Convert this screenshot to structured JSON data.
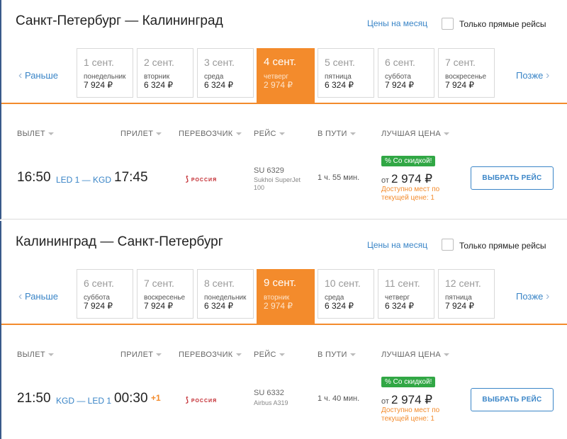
{
  "sections": [
    {
      "route": "Санкт-Петербург — Калининград",
      "month_link": "Цены на месяц",
      "direct_label": "Только прямые рейсы",
      "prev_label": "Раньше",
      "next_label": "Позже",
      "dates": [
        {
          "day": "1 сент.",
          "weekday": "понедельник",
          "price": "7 924 ₽"
        },
        {
          "day": "2 сент.",
          "weekday": "вторник",
          "price": "6 324 ₽"
        },
        {
          "day": "3 сент.",
          "weekday": "среда",
          "price": "6 324 ₽"
        },
        {
          "day": "4 сент.",
          "weekday": "четверг",
          "price": "2 974 ₽",
          "active": true
        },
        {
          "day": "5 сент.",
          "weekday": "пятница",
          "price": "6 324 ₽"
        },
        {
          "day": "6 сент.",
          "weekday": "суббота",
          "price": "7 924 ₽"
        },
        {
          "day": "7 сент.",
          "weekday": "воскресенье",
          "price": "7 924 ₽"
        }
      ],
      "headers": {
        "departure": "ВЫЛЕТ",
        "arrival": "ПРИЛЕТ",
        "carrier": "ПЕРЕВОЗЧИК",
        "flight": "РЕЙС",
        "duration": "В ПУТИ",
        "best_price": "ЛУЧШАЯ ЦЕНА"
      },
      "flight": {
        "dep_time": "16:50",
        "route_codes": "LED 1 — KGD",
        "arr_time": "17:45",
        "plus_day": "",
        "airline": "РОССИЯ",
        "number": "SU 6329",
        "aircraft_line1": "Sukhoi SuperJet",
        "aircraft_line2": "100",
        "duration": "1 ч. 55 мин.",
        "badge": "% Со скидкой!",
        "price_prefix": "от",
        "price": "2 974 ₽",
        "avail_line1": "Доступно мест по",
        "avail_line2": "текущей цене: 1",
        "button": "ВЫБРАТЬ РЕЙС"
      }
    },
    {
      "route": "Калининград — Санкт-Петербург",
      "month_link": "Цены на месяц",
      "direct_label": "Только прямые рейсы",
      "prev_label": "Раньше",
      "next_label": "Позже",
      "dates": [
        {
          "day": "6 сент.",
          "weekday": "суббота",
          "price": "7 924 ₽"
        },
        {
          "day": "7 сент.",
          "weekday": "воскресенье",
          "price": "7 924 ₽"
        },
        {
          "day": "8 сент.",
          "weekday": "понедельник",
          "price": "6 324 ₽"
        },
        {
          "day": "9 сент.",
          "weekday": "вторник",
          "price": "2 974 ₽",
          "active": true
        },
        {
          "day": "10 сент.",
          "weekday": "среда",
          "price": "6 324 ₽"
        },
        {
          "day": "11 сент.",
          "weekday": "четверг",
          "price": "6 324 ₽"
        },
        {
          "day": "12 сент.",
          "weekday": "пятница",
          "price": "7 924 ₽"
        }
      ],
      "headers": {
        "departure": "ВЫЛЕТ",
        "arrival": "ПРИЛЕТ",
        "carrier": "ПЕРЕВОЗЧИК",
        "flight": "РЕЙС",
        "duration": "В ПУТИ",
        "best_price": "ЛУЧШАЯ ЦЕНА"
      },
      "flight": {
        "dep_time": "21:50",
        "route_codes": "KGD — LED 1",
        "arr_time": "00:30",
        "plus_day": "+1",
        "airline": "РОССИЯ",
        "number": "SU 6332",
        "aircraft_line1": "Airbus A319",
        "aircraft_line2": "",
        "duration": "1 ч. 40 мин.",
        "badge": "% Со скидкой!",
        "price_prefix": "от",
        "price": "2 974 ₽",
        "avail_line1": "Доступно мест по",
        "avail_line2": "текущей цене: 1",
        "button": "ВЫБРАТЬ РЕЙС"
      }
    }
  ],
  "colors": {
    "accent": "#f38b2c",
    "link": "#3a85c7",
    "discount": "#31a745"
  },
  "icons": {
    "prev": "chevron-left-icon",
    "next": "chevron-right-icon",
    "airline": "rossiya-logo-icon"
  }
}
